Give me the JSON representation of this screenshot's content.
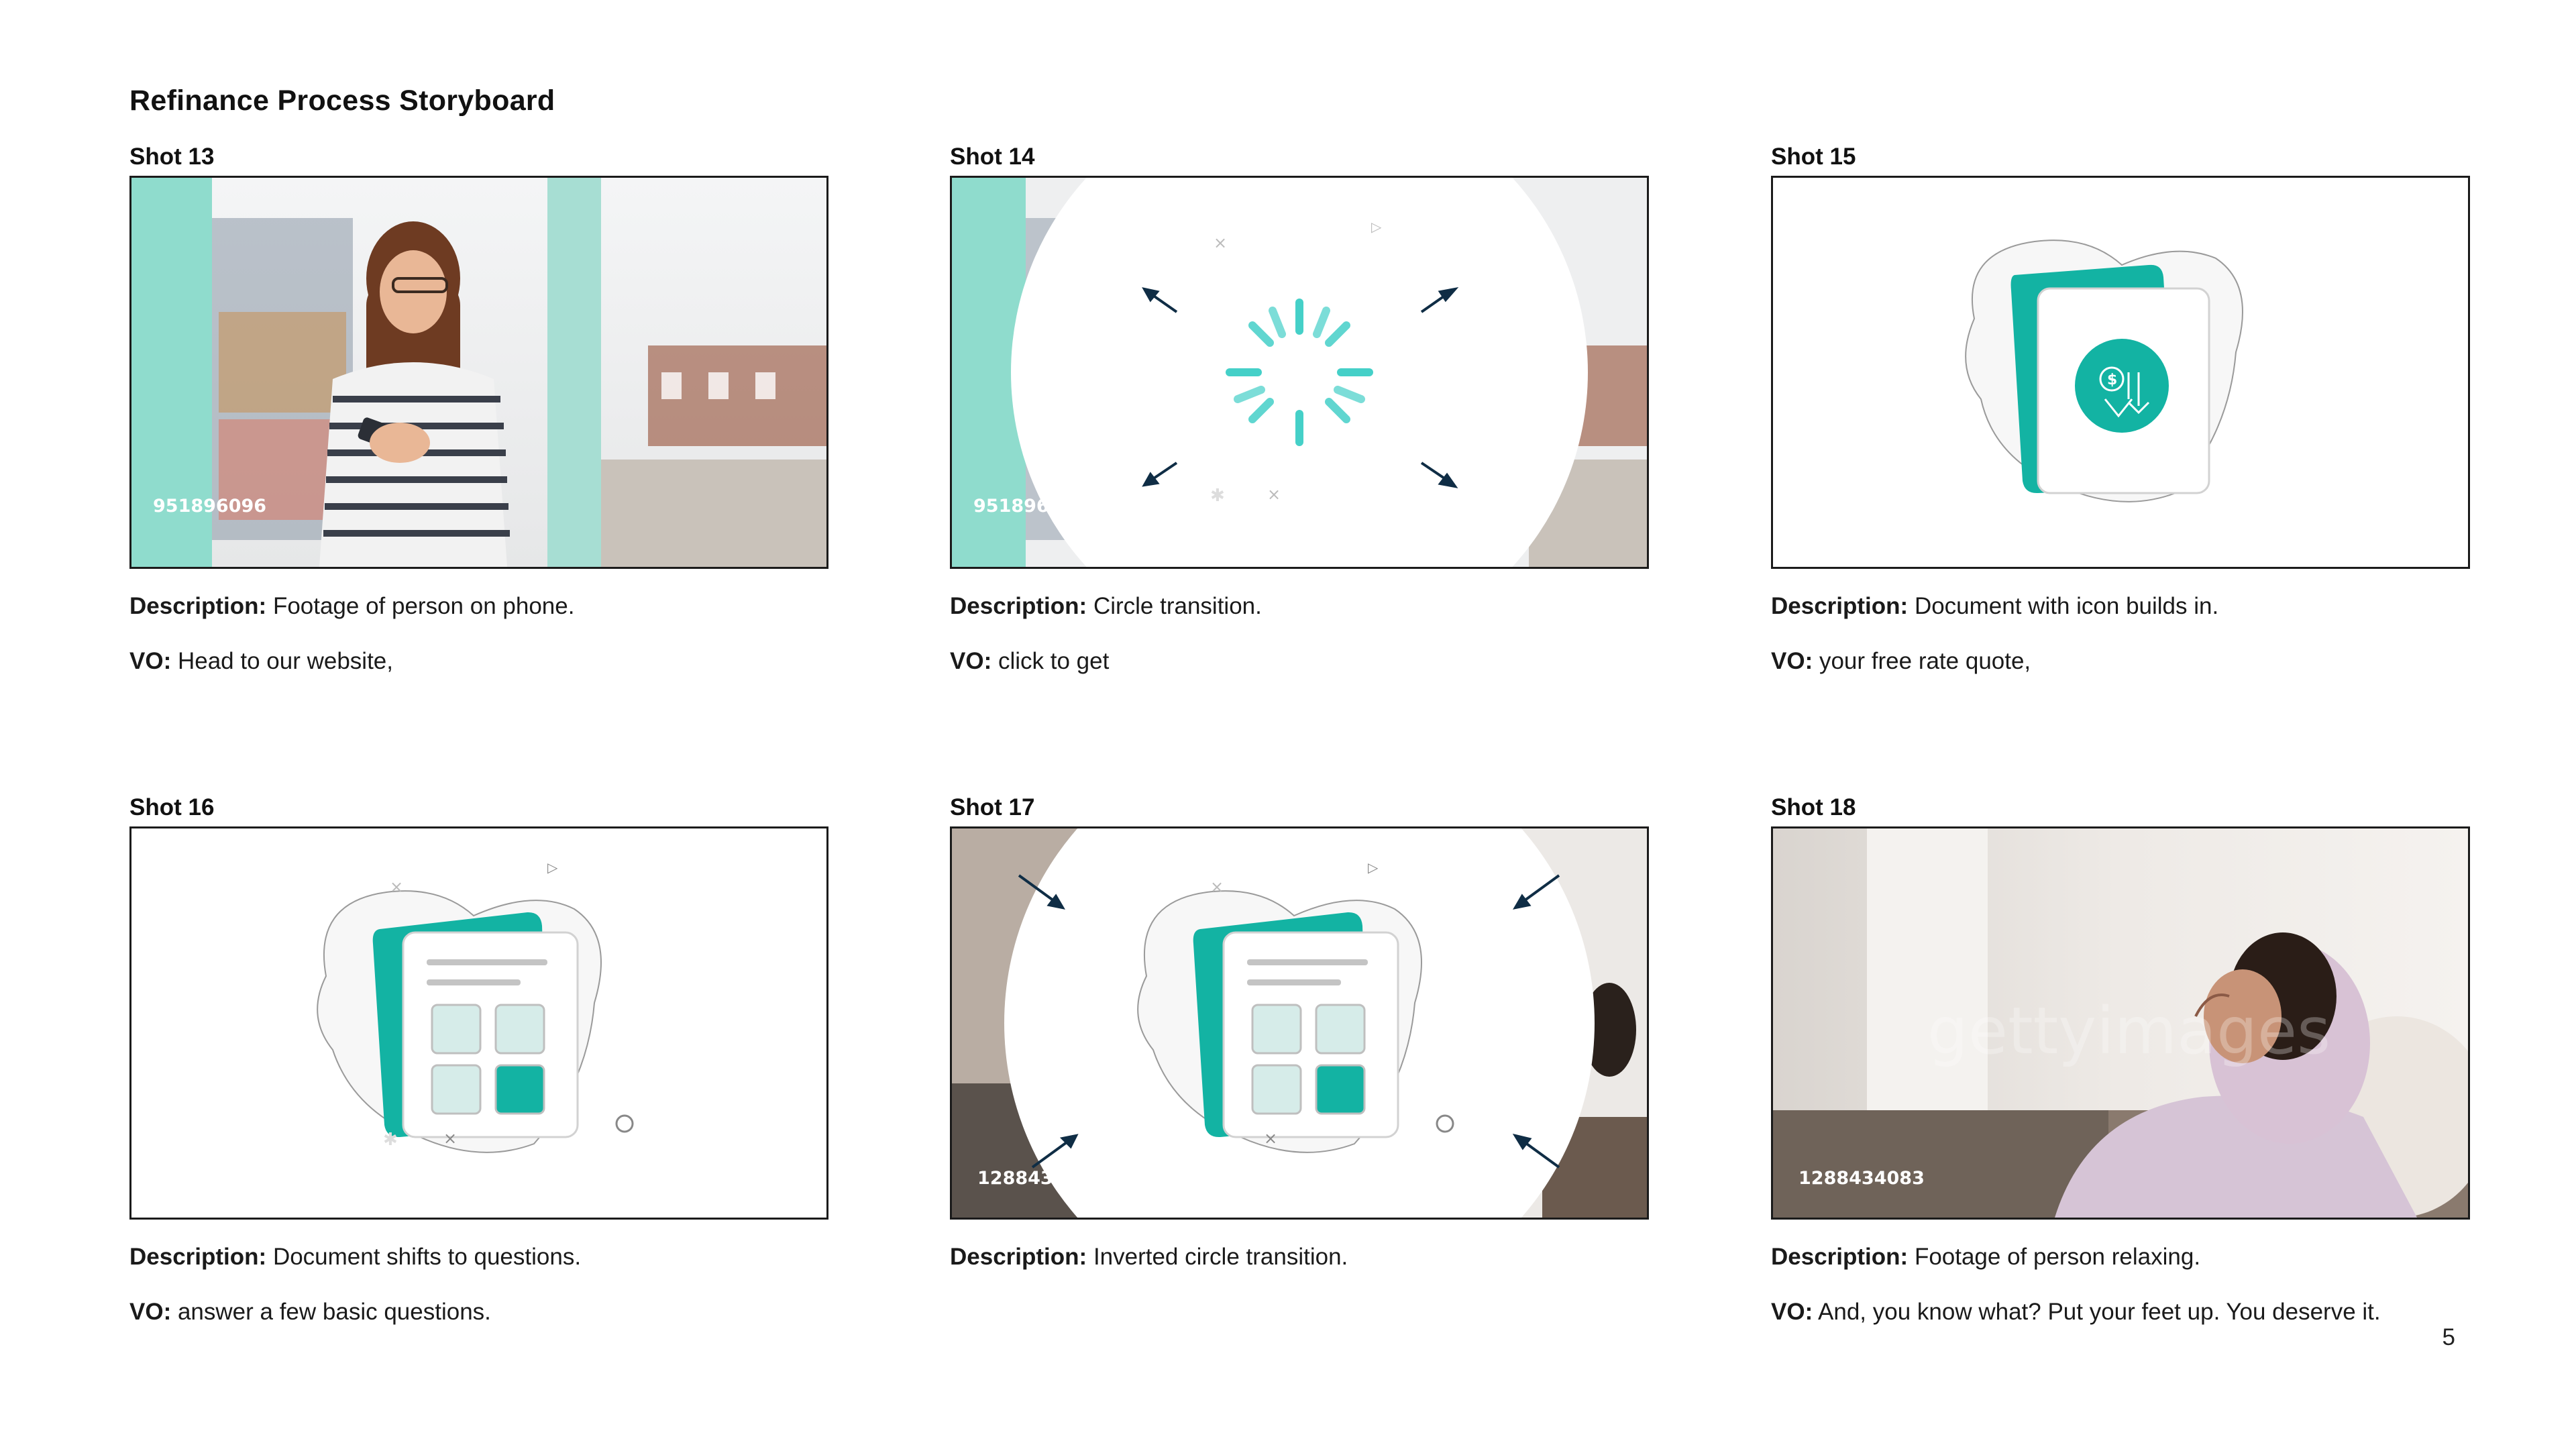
{
  "page": {
    "title": "Refinance Process Storyboard",
    "page_number": "5",
    "description_label": "Description:",
    "vo_label": "VO:"
  },
  "colors": {
    "teal": "#13b3a3",
    "light_teal": "#d6ece9",
    "navy_arrow": "#0f2d45",
    "spinner_teal": "#45d0c8"
  },
  "shots": [
    {
      "label": "Shot 13",
      "description": "Footage of person on phone.",
      "vo": "Head to our website,",
      "stock_id": "951896096",
      "image": "woman-on-phone-photo"
    },
    {
      "label": "Shot 14",
      "description": "Circle transition.",
      "vo": "click to get",
      "stock_id": "951896096",
      "image": "circle-transition-loader"
    },
    {
      "label": "Shot 15",
      "description": "Document with icon builds in.",
      "vo": "your free rate quote,",
      "image": "document-dollar-icon"
    },
    {
      "label": "Shot 16",
      "description": "Document shifts to questions.",
      "vo": "answer a few basic questions.",
      "image": "document-questions"
    },
    {
      "label": "Shot 17",
      "description": "Inverted circle transition.",
      "stock_id": "1288434083",
      "image": "inverted-circle-transition"
    },
    {
      "label": "Shot 18",
      "description": "Footage of person relaxing.",
      "vo": "And, you know what? Put your feet up. You deserve it.",
      "stock_id": "1288434083",
      "watermark": "gettyimages",
      "image": "woman-relaxing-photo"
    }
  ]
}
